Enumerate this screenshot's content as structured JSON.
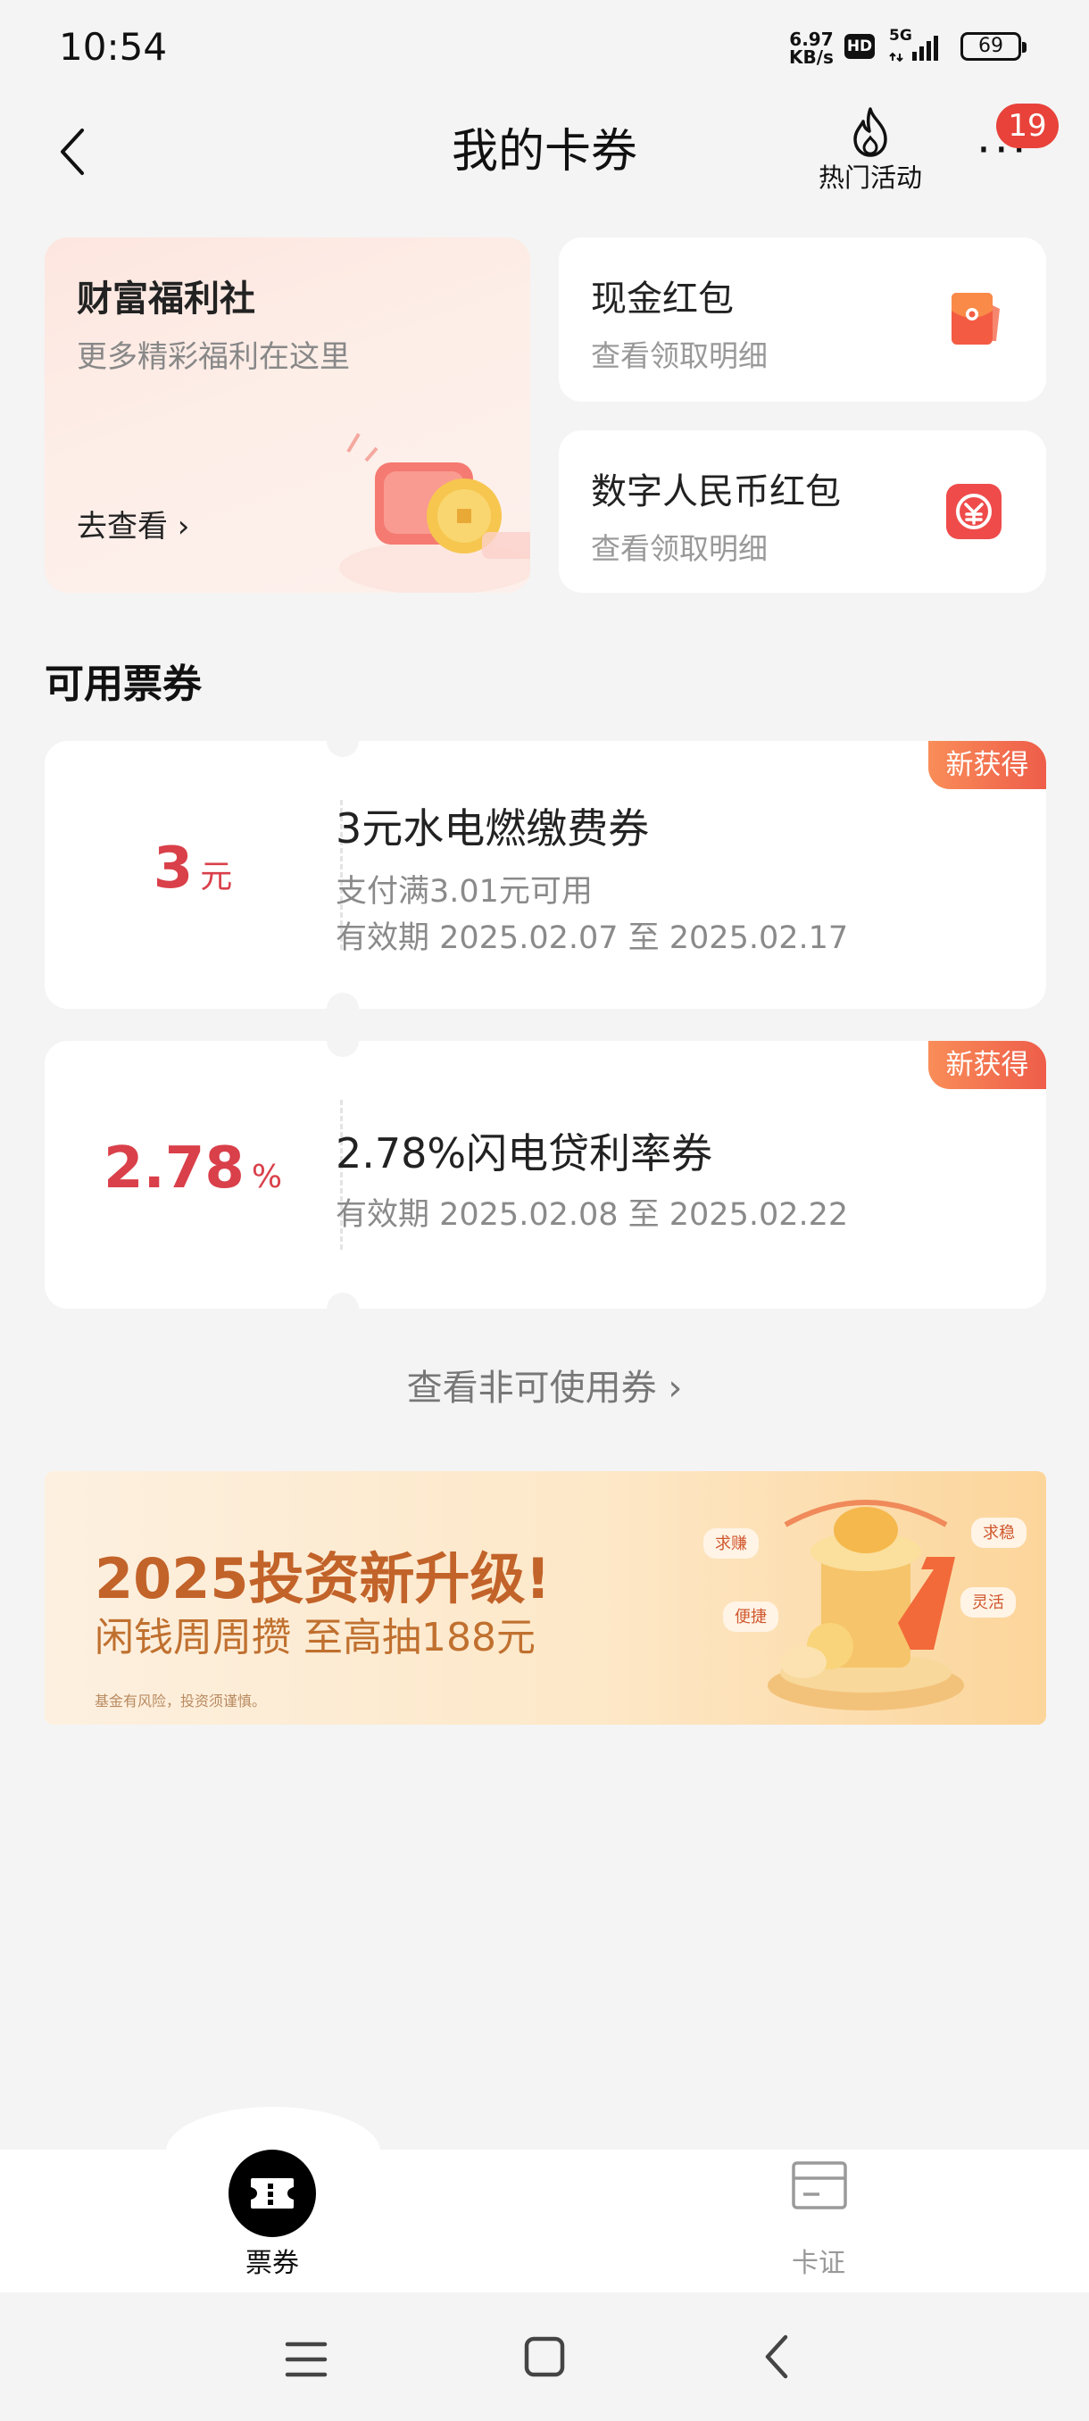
{
  "status_bar": {
    "time": "10:54",
    "net_speed_top": "6.97",
    "net_speed_bottom": "KB/s",
    "hd": "HD",
    "network": "5G",
    "battery": "69"
  },
  "header": {
    "title": "我的卡券",
    "hot_activity_label": "热门活动",
    "more_badge_count": "19"
  },
  "welfare_card": {
    "title": "财富福利社",
    "subtitle": "更多精彩福利在这里",
    "link": "去查看 ›"
  },
  "cash_card": {
    "title": "现金红包",
    "subtitle": "查看领取明细"
  },
  "digital_card": {
    "title": "数字人民币红包",
    "subtitle": "查看领取明细"
  },
  "section_title": "可用票券",
  "coupons": [
    {
      "value": "3",
      "unit": "元",
      "title": "3元水电燃缴费券",
      "condition": "支付满3.01元可用",
      "validity": "有效期 2025.02.07 至 2025.02.17",
      "badge": "新获得"
    },
    {
      "value": "2.78",
      "unit": "%",
      "title": "2.78%闪电贷利率券",
      "validity": "有效期 2025.02.08 至 2025.02.22",
      "badge": "新获得"
    }
  ],
  "view_unusable": "查看非可使用券 ›",
  "banner": {
    "headline": "2025投资新升级!",
    "subline": "闲钱周周攒  至高抽188元",
    "disclaimer": "基金有风险，投资须谨慎。",
    "tags": [
      "求赚",
      "求稳",
      "便捷",
      "灵活"
    ]
  },
  "bottom_nav": {
    "tabs": [
      {
        "label": "票券",
        "active": true
      },
      {
        "label": "卡证",
        "active": false
      }
    ]
  },
  "colors": {
    "accent_red": "#d9404a",
    "badge_orange": "#ee5d4a",
    "background": "#f4f4f4"
  }
}
